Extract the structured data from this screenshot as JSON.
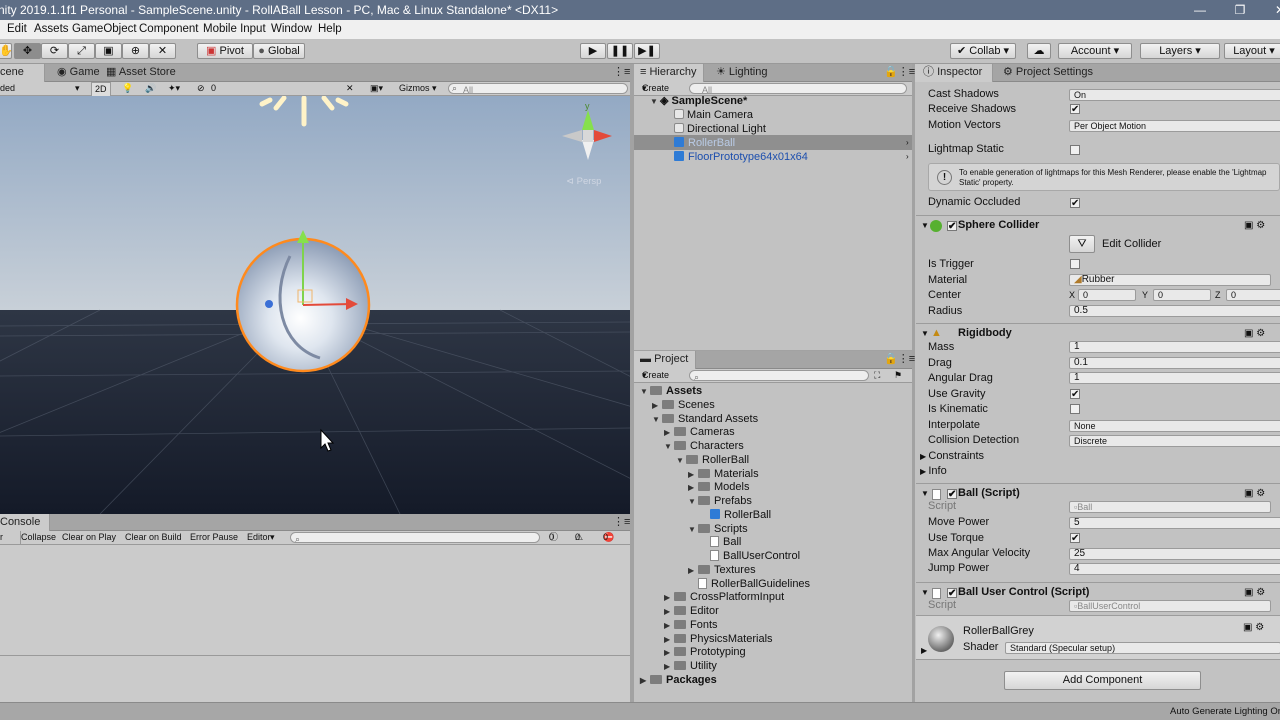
{
  "window": {
    "title": "nity 2019.1.1f1 Personal - SampleScene.unity - RollABall Lesson - PC, Mac & Linux Standalone* <DX11>"
  },
  "menu": [
    "Edit",
    "Assets",
    "GameObject",
    "Component",
    "Mobile Input",
    "Window",
    "Help"
  ],
  "toolbar": {
    "pivot": "Pivot",
    "global": "Global",
    "collab": "Collab",
    "account": "Account",
    "layers": "Layers",
    "layout": "Layout"
  },
  "scene": {
    "tabs": [
      "cene",
      "Game",
      "Asset Store"
    ],
    "shading": "ded",
    "mode2d": "2D",
    "fx_count": "0",
    "gizmos": "Gizmos",
    "search_placeholder": "All",
    "persp": "Persp"
  },
  "console": {
    "tab": "Console",
    "buttons": [
      "r",
      "Collapse",
      "Clear on Play",
      "Clear on Build",
      "Error Pause",
      "Editor"
    ],
    "counts": [
      "0",
      "0",
      "0"
    ]
  },
  "hierarchy": {
    "tabs": [
      "Hierarchy",
      "Lighting"
    ],
    "create": "Create",
    "search_placeholder": "All",
    "scene": "SampleScene*",
    "items": [
      "Main Camera",
      "Directional Light",
      "RollerBall",
      "FloorPrototype64x01x64"
    ]
  },
  "project": {
    "tab": "Project",
    "create": "Create",
    "tree": [
      {
        "label": "Assets",
        "depth": 0,
        "arrow": "down",
        "bold": true
      },
      {
        "label": "Scenes",
        "depth": 1,
        "arrow": "right"
      },
      {
        "label": "Standard Assets",
        "depth": 1,
        "arrow": "down"
      },
      {
        "label": "Cameras",
        "depth": 2,
        "arrow": "right"
      },
      {
        "label": "Characters",
        "depth": 2,
        "arrow": "down"
      },
      {
        "label": "RollerBall",
        "depth": 3,
        "arrow": "down"
      },
      {
        "label": "Materials",
        "depth": 4,
        "arrow": "right"
      },
      {
        "label": "Models",
        "depth": 4,
        "arrow": "right"
      },
      {
        "label": "Prefabs",
        "depth": 4,
        "arrow": "down"
      },
      {
        "label": "RollerBall",
        "depth": 5,
        "arrow": "none",
        "icon": "prefab"
      },
      {
        "label": "Scripts",
        "depth": 4,
        "arrow": "down"
      },
      {
        "label": "Ball",
        "depth": 5,
        "arrow": "none",
        "icon": "script"
      },
      {
        "label": "BallUserControl",
        "depth": 5,
        "arrow": "none",
        "icon": "script"
      },
      {
        "label": "Textures",
        "depth": 4,
        "arrow": "right"
      },
      {
        "label": "RollerBallGuidelines",
        "depth": 4,
        "arrow": "none",
        "icon": "doc"
      },
      {
        "label": "CrossPlatformInput",
        "depth": 2,
        "arrow": "right"
      },
      {
        "label": "Editor",
        "depth": 2,
        "arrow": "right"
      },
      {
        "label": "Fonts",
        "depth": 2,
        "arrow": "right"
      },
      {
        "label": "PhysicsMaterials",
        "depth": 2,
        "arrow": "right"
      },
      {
        "label": "Prototyping",
        "depth": 2,
        "arrow": "right"
      },
      {
        "label": "Utility",
        "depth": 2,
        "arrow": "right"
      },
      {
        "label": "Packages",
        "depth": 0,
        "arrow": "right",
        "bold": true
      }
    ]
  },
  "inspector": {
    "tabs": [
      "Inspector",
      "Project Settings"
    ],
    "mesh_renderer": {
      "cast_shadows_label": "Cast Shadows",
      "cast_shadows_value": "On",
      "receive_shadows_label": "Receive Shadows",
      "motion_vectors_label": "Motion Vectors",
      "motion_vectors_value": "Per Object Motion",
      "lightmap_static_label": "Lightmap Static",
      "info": "To enable generation of lightmaps for this Mesh Renderer, please enable the 'Lightmap Static' property.",
      "dynamic_occluded_label": "Dynamic Occluded"
    },
    "sphere_collider": {
      "title": "Sphere Collider",
      "edit_collider": "Edit Collider",
      "is_trigger_label": "Is Trigger",
      "material_label": "Material",
      "material_value": "Rubber",
      "center_label": "Center",
      "cx": "0",
      "cy": "0",
      "cz": "0",
      "x": "X",
      "y": "Y",
      "z": "Z",
      "radius_label": "Radius",
      "radius_value": "0.5"
    },
    "rigidbody": {
      "title": "Rigidbody",
      "mass_label": "Mass",
      "mass": "1",
      "drag_label": "Drag",
      "drag": "0.1",
      "angular_drag_label": "Angular Drag",
      "angular_drag": "1",
      "use_gravity_label": "Use Gravity",
      "is_kinematic_label": "Is Kinematic",
      "interpolate_label": "Interpolate",
      "interpolate": "None",
      "collision_label": "Collision Detection",
      "collision": "Discrete",
      "constraints": "Constraints",
      "info": "Info"
    },
    "ball_script": {
      "title": "Ball (Script)",
      "script_label": "Script",
      "script_value": "Ball",
      "move_power_label": "Move Power",
      "move_power": "5",
      "use_torque_label": "Use Torque",
      "max_ang_label": "Max Angular Velocity",
      "max_ang": "25",
      "jump_power_label": "Jump Power",
      "jump_power": "4"
    },
    "ball_user_control": {
      "title": "Ball User Control (Script)",
      "script_label": "Script",
      "script_value": "BallUserControl"
    },
    "material": {
      "name": "RollerBallGrey",
      "shader_label": "Shader",
      "shader": "Standard (Specular setup)"
    },
    "add_component": "Add Component"
  },
  "status": {
    "text": "Auto Generate Lighting On"
  }
}
